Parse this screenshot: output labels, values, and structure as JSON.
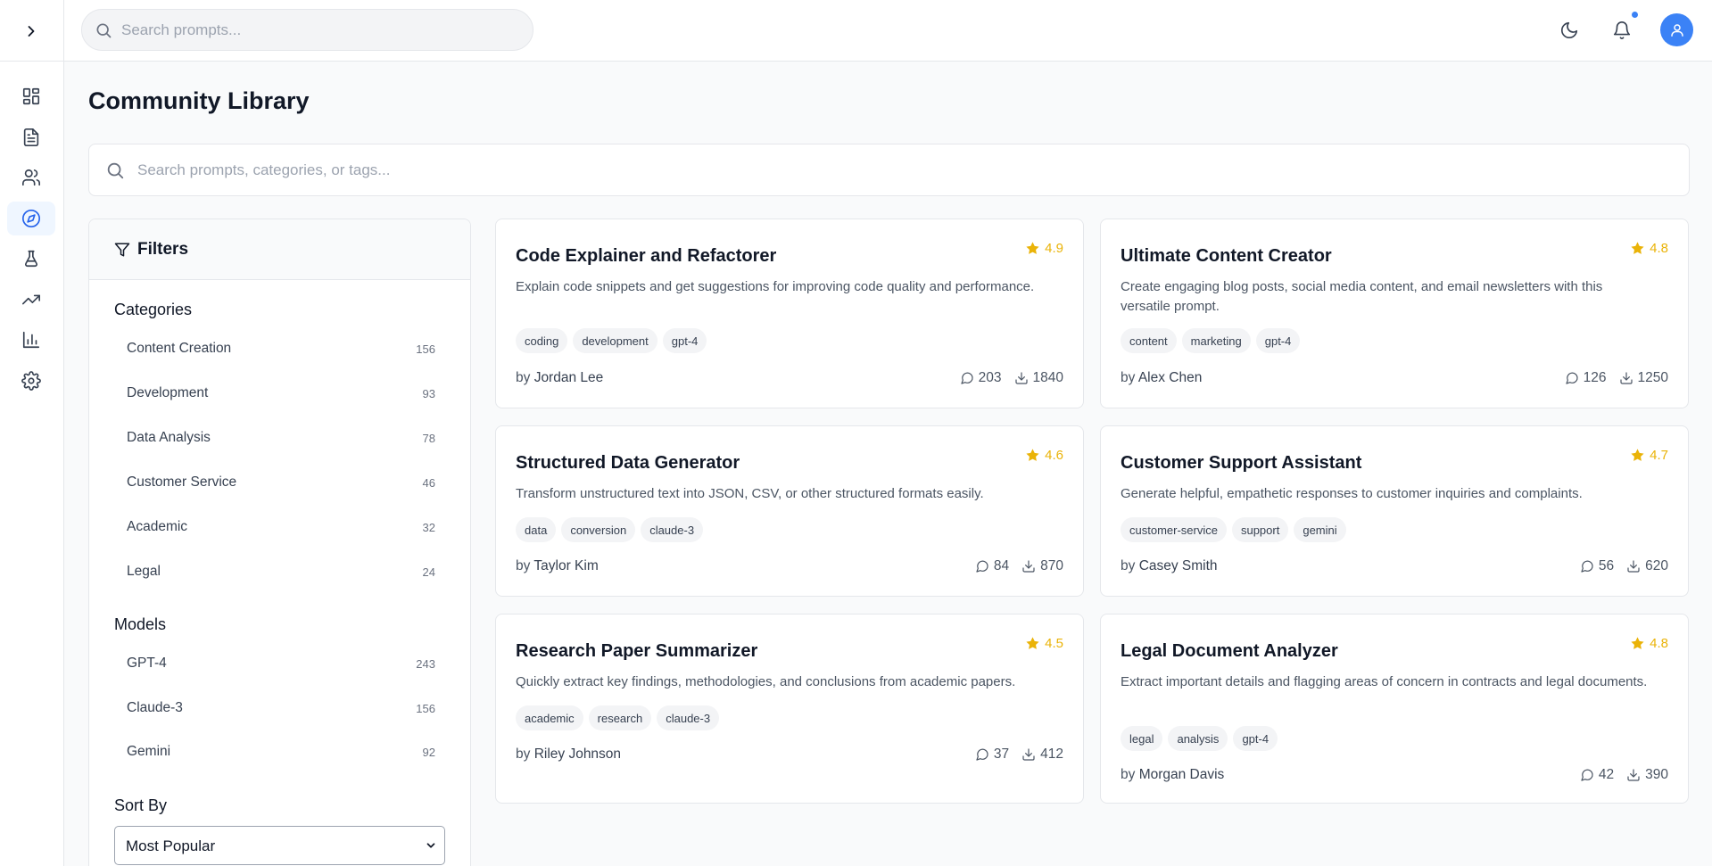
{
  "topbar": {
    "search_placeholder": "Search prompts...",
    "icons": [
      "moon-icon",
      "bell-icon",
      "user-icon"
    ],
    "accent": "#3b82f6"
  },
  "sidebar": {
    "toggle_icon": "chevron-right-icon",
    "items": [
      {
        "icon": "dashboard-icon",
        "active": false
      },
      {
        "icon": "document-icon",
        "active": false
      },
      {
        "icon": "users-icon",
        "active": false
      },
      {
        "icon": "compass-icon",
        "active": true
      },
      {
        "icon": "flask-icon",
        "active": false
      },
      {
        "icon": "trending-icon",
        "active": false
      },
      {
        "icon": "bar-chart-icon",
        "active": false
      },
      {
        "icon": "settings-icon",
        "active": false
      }
    ]
  },
  "page": {
    "title": "Community Library",
    "search_placeholder": "Search prompts, categories, or tags..."
  },
  "filters": {
    "title": "Filters",
    "categories_title": "Categories",
    "categories": [
      {
        "label": "Content Creation",
        "count": "156"
      },
      {
        "label": "Development",
        "count": "93"
      },
      {
        "label": "Data Analysis",
        "count": "78"
      },
      {
        "label": "Customer Service",
        "count": "46"
      },
      {
        "label": "Academic",
        "count": "32"
      },
      {
        "label": "Legal",
        "count": "24"
      }
    ],
    "models_title": "Models",
    "models": [
      {
        "label": "GPT-4",
        "count": "243"
      },
      {
        "label": "Claude-3",
        "count": "156"
      },
      {
        "label": "Gemini",
        "count": "92"
      }
    ],
    "sort_title": "Sort By",
    "sort_value": "Most Popular"
  },
  "cards": [
    {
      "title": "Code Explainer and Refactorer",
      "rating": "4.9",
      "description": "Explain code snippets and get suggestions for improving code quality and performance.",
      "tags": [
        "coding",
        "development",
        "gpt-4"
      ],
      "by": "by",
      "author": "Jordan Lee",
      "comments": "203",
      "downloads": "1840"
    },
    {
      "title": "Ultimate Content Creator",
      "rating": "4.8",
      "description": "Create engaging blog posts, social media content, and email newsletters with this versatile prompt.",
      "tags": [
        "content",
        "marketing",
        "gpt-4"
      ],
      "by": "by",
      "author": "Alex Chen",
      "comments": "126",
      "downloads": "1250"
    },
    {
      "title": "Structured Data Generator",
      "rating": "4.6",
      "description": "Transform unstructured text into JSON, CSV, or other structured formats easily.",
      "tags": [
        "data",
        "conversion",
        "claude-3"
      ],
      "by": "by",
      "author": "Taylor Kim",
      "comments": "84",
      "downloads": "870"
    },
    {
      "title": "Customer Support Assistant",
      "rating": "4.7",
      "description": "Generate helpful, empathetic responses to customer inquiries and complaints.",
      "tags": [
        "customer-service",
        "support",
        "gemini"
      ],
      "by": "by",
      "author": "Casey Smith",
      "comments": "56",
      "downloads": "620"
    },
    {
      "title": "Research Paper Summarizer",
      "rating": "4.5",
      "description": "Quickly extract key findings, methodologies, and conclusions from academic papers.",
      "tags": [
        "academic",
        "research",
        "claude-3"
      ],
      "by": "by",
      "author": "Riley Johnson",
      "comments": "37",
      "downloads": "412"
    },
    {
      "title": "Legal Document Analyzer",
      "rating": "4.8",
      "description": "Extract important details and flagging areas of concern in contracts and legal documents.",
      "tags": [
        "legal",
        "analysis",
        "gpt-4"
      ],
      "by": "by",
      "author": "Morgan Davis",
      "comments": "42",
      "downloads": "390"
    }
  ]
}
